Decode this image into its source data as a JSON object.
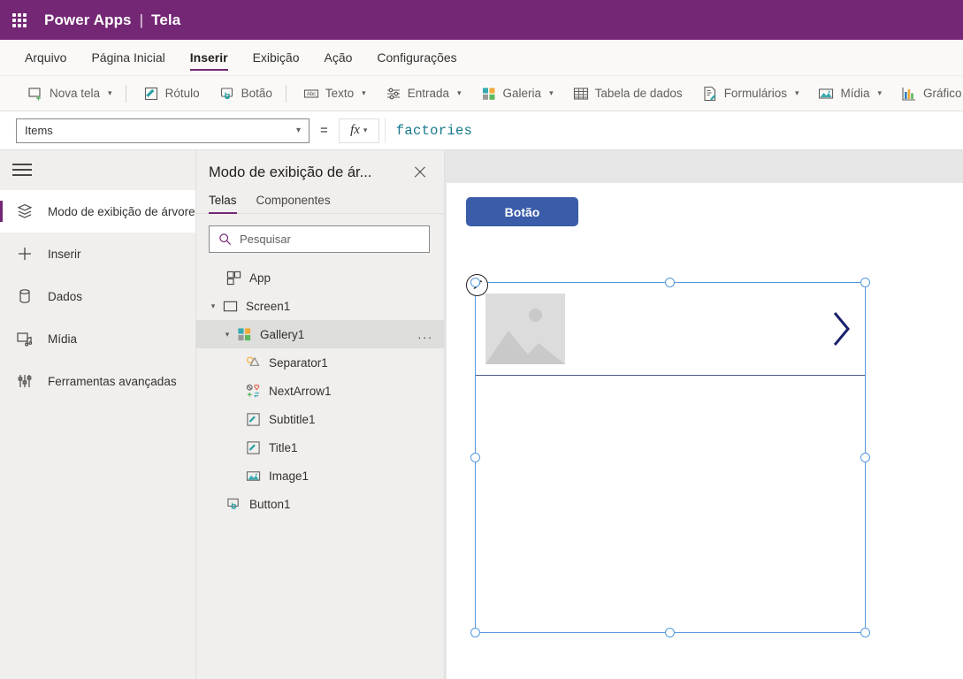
{
  "titlebar": {
    "waffle_icon": "waffle-grid-icon",
    "brand": "Power Apps",
    "separator": "|",
    "document": "Tela"
  },
  "menubar": {
    "items": [
      {
        "label": "Arquivo",
        "active": false
      },
      {
        "label": "Página Inicial",
        "active": false
      },
      {
        "label": "Inserir",
        "active": true
      },
      {
        "label": "Exibição",
        "active": false
      },
      {
        "label": "Ação",
        "active": false
      },
      {
        "label": "Configurações",
        "active": false
      }
    ]
  },
  "ribbon": {
    "items": [
      {
        "label": "Nova tela",
        "icon": "new-screen-icon",
        "has_caret": true
      },
      {
        "label": "Rótulo",
        "icon": "label-icon",
        "has_caret": false
      },
      {
        "label": "Botão",
        "icon": "button-icon",
        "has_caret": false
      },
      {
        "label": "Texto",
        "icon": "text-input-icon",
        "has_caret": true
      },
      {
        "label": "Entrada",
        "icon": "controls-icon",
        "has_caret": true
      },
      {
        "label": "Galeria",
        "icon": "gallery-icon",
        "has_caret": true
      },
      {
        "label": "Tabela de dados",
        "icon": "data-table-icon",
        "has_caret": false
      },
      {
        "label": "Formulários",
        "icon": "forms-icon",
        "has_caret": true
      },
      {
        "label": "Mídia",
        "icon": "media-icon",
        "has_caret": true
      },
      {
        "label": "Gráfico",
        "icon": "chart-icon",
        "has_caret": false
      }
    ]
  },
  "formulabar": {
    "property": "Items",
    "equals": "=",
    "fx_label": "fx",
    "formula": "factories"
  },
  "rail": {
    "hamburger_icon": "hamburger-menu-icon",
    "items": [
      {
        "label": "Modo de exibição de árvore",
        "icon": "tree-view-icon",
        "active": true
      },
      {
        "label": "Inserir",
        "icon": "plus-icon",
        "active": false
      },
      {
        "label": "Dados",
        "icon": "database-icon",
        "active": false
      },
      {
        "label": "Mídia",
        "icon": "media-icon",
        "active": false
      },
      {
        "label": "Ferramentas avançadas",
        "icon": "advanced-tools-icon",
        "active": false
      }
    ]
  },
  "treepanel": {
    "title": "Modo de exibição de ár...",
    "close_icon": "close-icon",
    "tabs": [
      {
        "label": "Telas",
        "active": true
      },
      {
        "label": "Componentes",
        "active": false
      }
    ],
    "search": {
      "placeholder": "Pesquisar",
      "value": "",
      "icon": "search-icon"
    },
    "nodes": [
      {
        "label": "App",
        "icon": "app-icon",
        "indent": 0,
        "chevron": "none",
        "selected": false,
        "overflow": false
      },
      {
        "label": "Screen1",
        "icon": "screen-icon",
        "indent": 0,
        "chevron": "down",
        "selected": false,
        "overflow": false
      },
      {
        "label": "Gallery1",
        "icon": "gallery-icon",
        "indent": 1,
        "chevron": "down",
        "selected": true,
        "overflow": true,
        "overflow_label": "..."
      },
      {
        "label": "Separator1",
        "icon": "separator-icon",
        "indent": 2,
        "chevron": "none",
        "selected": false,
        "overflow": false
      },
      {
        "label": "NextArrow1",
        "icon": "next-arrow-icon",
        "indent": 2,
        "chevron": "none",
        "selected": false,
        "overflow": false
      },
      {
        "label": "Subtitle1",
        "icon": "label-icon",
        "indent": 2,
        "chevron": "none",
        "selected": false,
        "overflow": false
      },
      {
        "label": "Title1",
        "icon": "label-icon",
        "indent": 2,
        "chevron": "none",
        "selected": false,
        "overflow": false
      },
      {
        "label": "Image1",
        "icon": "image-icon",
        "indent": 2,
        "chevron": "none",
        "selected": false,
        "overflow": false
      },
      {
        "label": "Button1",
        "icon": "button-icon",
        "indent": 1,
        "chevron": "none",
        "selected": false,
        "overflow": false
      }
    ]
  },
  "canvas": {
    "button_label": "Botão",
    "button_color": "#3a5ca9",
    "selection_color": "#5699de",
    "gallery": {
      "image_placeholder_icon": "image-placeholder-icon",
      "edit_badge_icon": "pencil-edit-icon",
      "next_arrow_icon": "chevron-right-icon"
    }
  },
  "colors": {
    "brand_purple": "#742774",
    "accent_teal": "#18798a",
    "canvas_gray": "#e6e6e6",
    "panel_gray": "#f0efee"
  }
}
